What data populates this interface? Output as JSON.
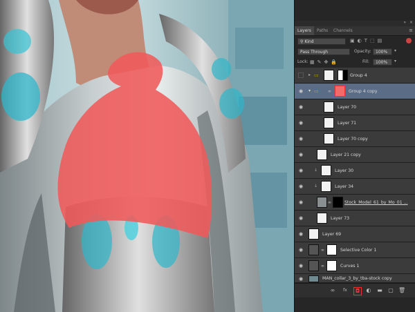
{
  "panel": {
    "tabs": [
      {
        "label": "Layers"
      },
      {
        "label": "Paths"
      },
      {
        "label": "Channels"
      }
    ],
    "filter_value": "Kind",
    "blend_mode": "Pass Through",
    "opacity_label": "Opacity:",
    "opacity_value": "100%",
    "lock_label": "Lock:",
    "fill_label": "Fill:",
    "fill_value": "100%",
    "layers": [
      {
        "name": "Group 4"
      },
      {
        "name": "Group 4 copy"
      },
      {
        "name": "Layer 70"
      },
      {
        "name": "Layer 71"
      },
      {
        "name": "Layer 70 copy"
      },
      {
        "name": "Layer 21 copy"
      },
      {
        "name": "Layer 30"
      },
      {
        "name": "Layer 34"
      },
      {
        "name": "Stock_Model_61_by_Mo_01 ..."
      },
      {
        "name": "Layer 73"
      },
      {
        "name": "Layer 69"
      },
      {
        "name": "Selective Color 1"
      },
      {
        "name": "Curves 1"
      },
      {
        "name": "MAN_collar_3_by_tba-stock copy"
      }
    ],
    "bottom_icons": [
      "link-icon",
      "fx-icon",
      "mask-icon",
      "adjustment-icon",
      "folder-icon",
      "new-layer-icon",
      "trash-icon"
    ]
  }
}
